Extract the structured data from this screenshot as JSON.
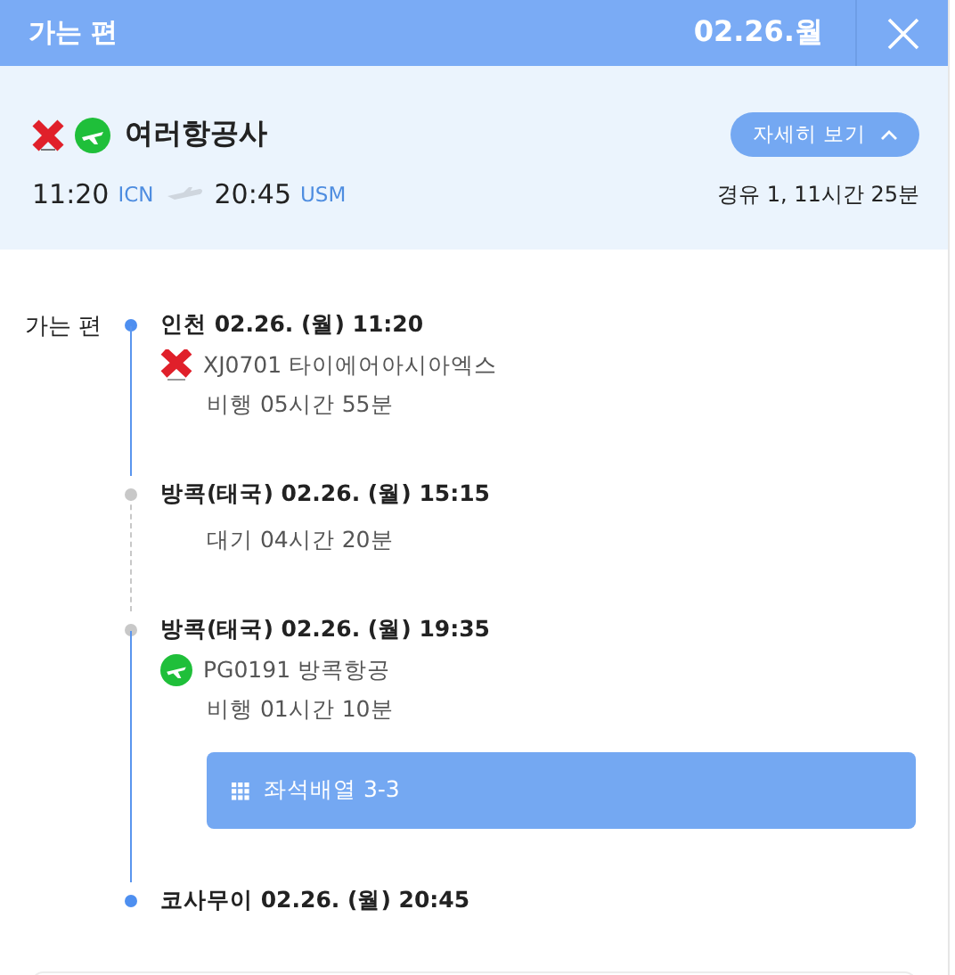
{
  "header": {
    "title": "가는 편",
    "date": "02.26.월"
  },
  "summary": {
    "airlines": [
      {
        "kind": "x"
      },
      {
        "kind": "plane"
      }
    ],
    "airline_name": "여러항공사",
    "details_button": "자세히 보기",
    "expanded": true,
    "depart_time": "11:20",
    "depart_code": "ICN",
    "arrive_time": "20:45",
    "arrive_code": "USM",
    "stops_duration": "경유 1, 11시간 25분"
  },
  "timeline": {
    "label": "가는 편",
    "stops": [
      {
        "kind": "depart",
        "place_time": "인천 02.26. (월) 11:20",
        "flight": {
          "kind": "x",
          "text": "XJ0701 타이에어아시아엑스"
        },
        "duration": "비행 05시간 55분"
      },
      {
        "kind": "layover_start",
        "place_time": "방콕(태국) 02.26. (월) 15:15",
        "duration": "대기 04시간 20분"
      },
      {
        "kind": "layover_end",
        "place_time": "방콕(태국) 02.26. (월) 19:35",
        "flight": {
          "kind": "plane",
          "text": "PG0191 방콕항공"
        },
        "duration": "비행 01시간 10분",
        "seat_button": "좌석배열 3-3"
      },
      {
        "kind": "arrive",
        "place_time": "코사무이 02.26. (월) 20:45"
      }
    ]
  }
}
